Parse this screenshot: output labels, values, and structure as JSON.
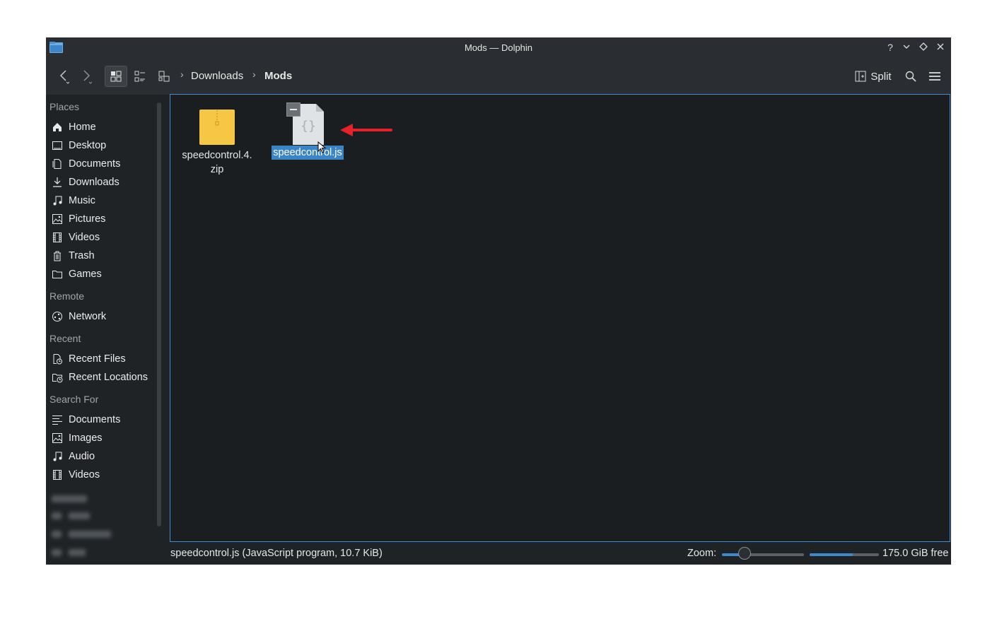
{
  "window": {
    "title": "Mods — Dolphin"
  },
  "toolbar": {
    "breadcrumb": [
      "Downloads",
      "Mods"
    ],
    "split_label": "Split"
  },
  "sidebar": {
    "places_header": "Places",
    "places": [
      {
        "label": "Home",
        "icon": "home-icon"
      },
      {
        "label": "Desktop",
        "icon": "desktop-icon"
      },
      {
        "label": "Documents",
        "icon": "documents-icon"
      },
      {
        "label": "Downloads",
        "icon": "downloads-icon"
      },
      {
        "label": "Music",
        "icon": "music-icon"
      },
      {
        "label": "Pictures",
        "icon": "pictures-icon"
      },
      {
        "label": "Videos",
        "icon": "videos-icon"
      },
      {
        "label": "Trash",
        "icon": "trash-icon"
      },
      {
        "label": "Games",
        "icon": "folder-icon"
      }
    ],
    "remote_header": "Remote",
    "remote": [
      {
        "label": "Network",
        "icon": "network-icon"
      }
    ],
    "recent_header": "Recent",
    "recent": [
      {
        "label": "Recent Files",
        "icon": "recent-files-icon"
      },
      {
        "label": "Recent Locations",
        "icon": "recent-locations-icon"
      }
    ],
    "search_header": "Search For",
    "search": [
      {
        "label": "Documents",
        "icon": "text-doc-icon"
      },
      {
        "label": "Images",
        "icon": "image-icon"
      },
      {
        "label": "Audio",
        "icon": "audio-icon"
      },
      {
        "label": "Videos",
        "icon": "video-icon"
      }
    ]
  },
  "files": [
    {
      "name_line1": "speedcontrol.4.",
      "name_line2": "zip",
      "type": "zip-archive-icon"
    },
    {
      "name": "speedcontrol.js",
      "type": "javascript-file-icon",
      "selected": true
    }
  ],
  "statusbar": {
    "text": "speedcontrol.js (JavaScript program, 10.7 KiB)",
    "zoom_label": "Zoom:",
    "zoom_level": 0.28,
    "disk_used_fraction": 0.62,
    "free_text": "175.0 GiB free"
  },
  "colors": {
    "accent": "#3d89cc",
    "selection": "#3b84c5",
    "annotation_arrow": "#e8202a"
  }
}
